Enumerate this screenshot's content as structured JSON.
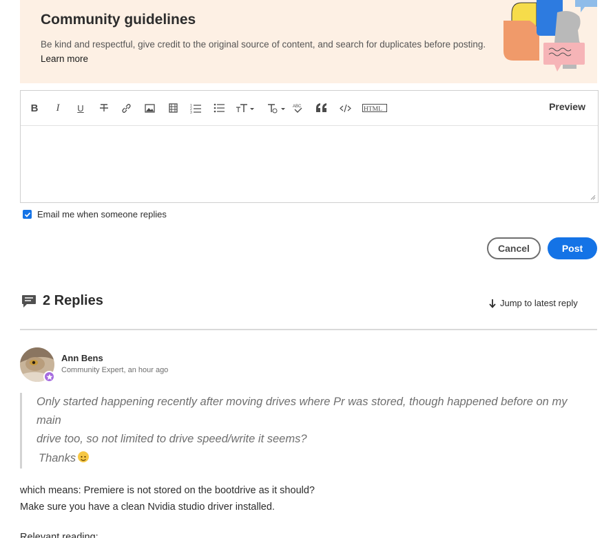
{
  "guidelines": {
    "title": "Community guidelines",
    "text": "Be kind and respectful, give credit to the original source of content, and search for duplicates before posting.",
    "link": "Learn more"
  },
  "editor": {
    "toolbar": {
      "items": [
        "bold-icon",
        "italic-icon",
        "underline-icon",
        "strikethrough-icon",
        "link-icon",
        "image-icon",
        "video-icon",
        "numbered-list-icon",
        "bulleted-list-icon",
        "font-size-icon",
        "clear-formatting-icon",
        "spellcheck-icon",
        "quote-icon",
        "code-icon",
        "html-icon"
      ],
      "bold": "B",
      "italic": "I",
      "underline": "U",
      "preview": "Preview"
    }
  },
  "email_option": {
    "label": "Email me when someone replies",
    "checked": true
  },
  "actions": {
    "cancel": "Cancel",
    "post": "Post"
  },
  "replies": {
    "title": "2 Replies",
    "jump_label": "Jump to latest reply"
  },
  "reply": {
    "author": "Ann Bens",
    "meta": "Community Expert, an hour ago",
    "quote_line1": "Only started happening recently after moving drives where Pr was stored, though happened before on my main",
    "quote_line2": "drive too, so not limited to drive speed/write it seems?",
    "quote_thanks": "Thanks",
    "body_line1": "which means: Premiere is not stored on the bootdrive as it should?",
    "body_line2": "Make sure you have a clean Nvidia studio driver installed.",
    "body_line3": "Relevant reading:"
  },
  "colors": {
    "accent": "#1473e6",
    "banner_bg": "#fdf0e4",
    "badge": "#a56bdf"
  }
}
